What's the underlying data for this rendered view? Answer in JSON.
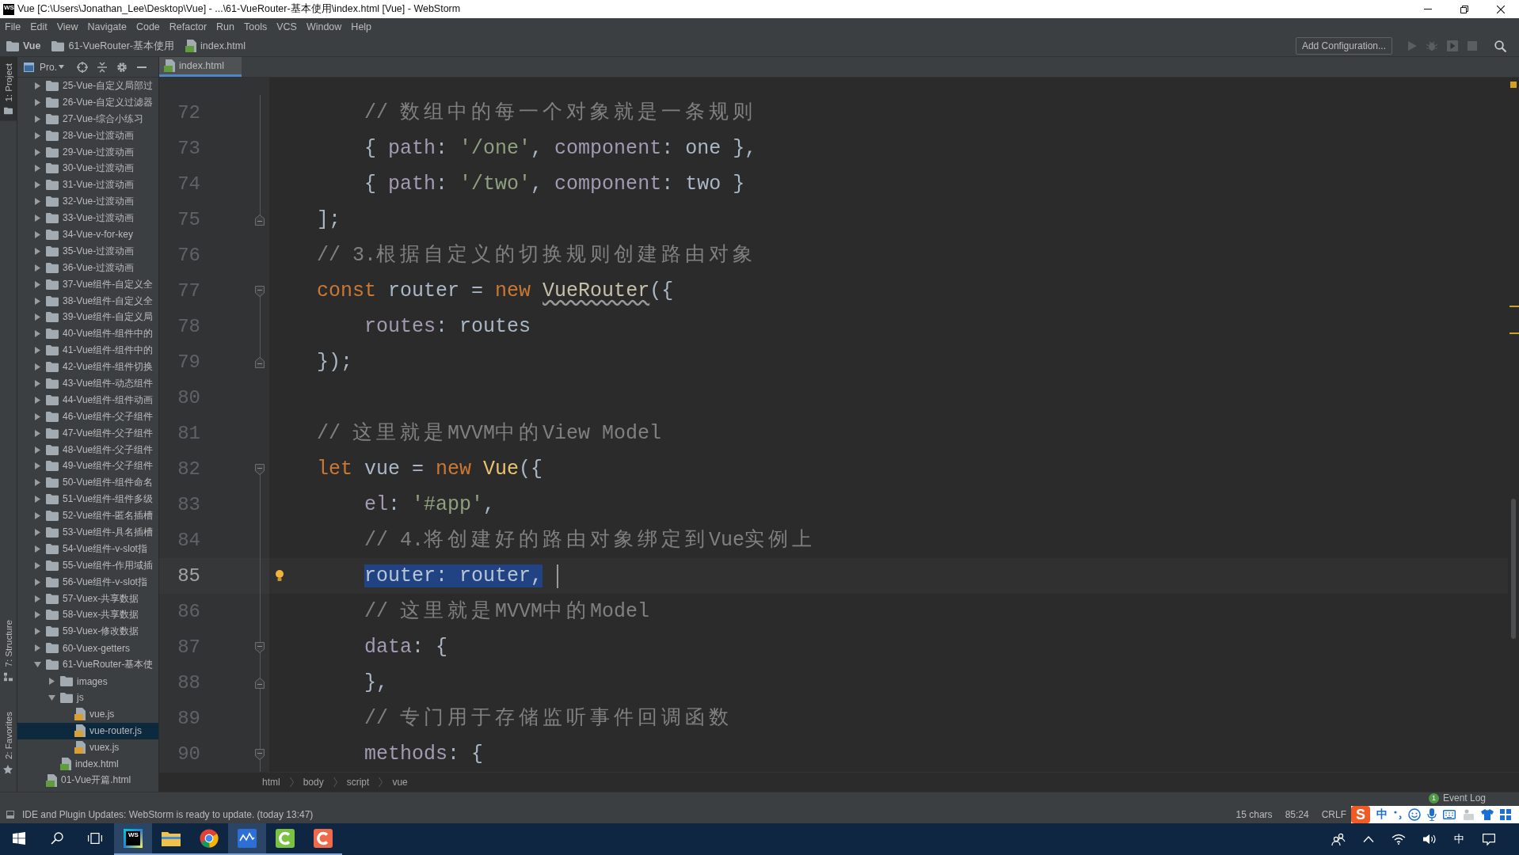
{
  "window": {
    "icon_text": "WS",
    "title": "Vue [C:\\Users\\Jonathan_Lee\\Desktop\\Vue] - ...\\61-VueRouter-基本使用\\index.html [Vue] - WebStorm"
  },
  "menu": [
    "File",
    "Edit",
    "View",
    "Navigate",
    "Code",
    "Refactor",
    "Run",
    "Tools",
    "VCS",
    "Window",
    "Help"
  ],
  "navigation_bar": {
    "crumbs": [
      {
        "label": "Vue",
        "kind": "project"
      },
      {
        "label": "61-VueRouter-基本使用",
        "kind": "folder"
      },
      {
        "label": "index.html",
        "kind": "html"
      }
    ],
    "run_configuration": "Add Configuration...",
    "run_actions_enabled": false
  },
  "left_stripe": {
    "top": [
      {
        "label": "1: Project",
        "kind": "project",
        "selected": true
      }
    ],
    "bottom": [
      {
        "label": "7: Structure",
        "kind": "structure",
        "selected": false
      },
      {
        "label": "2: Favorites",
        "kind": "favorites",
        "selected": false
      }
    ]
  },
  "project_panel": {
    "title": "Pro.",
    "tree": [
      {
        "label": "25-Vue-自定义局部过",
        "kind": "folder",
        "expanded": false,
        "selected": false
      },
      {
        "label": "26-Vue-自定义过滤器",
        "kind": "folder",
        "expanded": false,
        "selected": false
      },
      {
        "label": "27-Vue-综合小练习",
        "kind": "folder",
        "expanded": false,
        "selected": false
      },
      {
        "label": "28-Vue-过渡动画",
        "kind": "folder",
        "expanded": false,
        "selected": false
      },
      {
        "label": "29-Vue-过渡动画",
        "kind": "folder",
        "expanded": false,
        "selected": false
      },
      {
        "label": "30-Vue-过渡动画",
        "kind": "folder",
        "expanded": false,
        "selected": false
      },
      {
        "label": "31-Vue-过渡动画",
        "kind": "folder",
        "expanded": false,
        "selected": false
      },
      {
        "label": "32-Vue-过渡动画",
        "kind": "folder",
        "expanded": false,
        "selected": false
      },
      {
        "label": "33-Vue-过渡动画",
        "kind": "folder",
        "expanded": false,
        "selected": false
      },
      {
        "label": "34-Vue-v-for-key",
        "kind": "folder",
        "expanded": false,
        "selected": false
      },
      {
        "label": "35-Vue-过渡动画",
        "kind": "folder",
        "expanded": false,
        "selected": false
      },
      {
        "label": "36-Vue-过渡动画",
        "kind": "folder",
        "expanded": false,
        "selected": false
      },
      {
        "label": "37-Vue组件-自定义全",
        "kind": "folder",
        "expanded": false,
        "selected": false
      },
      {
        "label": "38-Vue组件-自定义全",
        "kind": "folder",
        "expanded": false,
        "selected": false
      },
      {
        "label": "39-Vue组件-自定义局",
        "kind": "folder",
        "expanded": false,
        "selected": false
      },
      {
        "label": "40-Vue组件-组件中的",
        "kind": "folder",
        "expanded": false,
        "selected": false
      },
      {
        "label": "41-Vue组件-组件中的",
        "kind": "folder",
        "expanded": false,
        "selected": false
      },
      {
        "label": "42-Vue组件-组件切换",
        "kind": "folder",
        "expanded": false,
        "selected": false
      },
      {
        "label": "43-Vue组件-动态组件",
        "kind": "folder",
        "expanded": false,
        "selected": false
      },
      {
        "label": "44-Vue组件-组件动画",
        "kind": "folder",
        "expanded": false,
        "selected": false
      },
      {
        "label": "46-Vue组件-父子组件",
        "kind": "folder",
        "expanded": false,
        "selected": false
      },
      {
        "label": "47-Vue组件-父子组件",
        "kind": "folder",
        "expanded": false,
        "selected": false
      },
      {
        "label": "48-Vue组件-父子组件",
        "kind": "folder",
        "expanded": false,
        "selected": false
      },
      {
        "label": "49-Vue组件-父子组件",
        "kind": "folder",
        "expanded": false,
        "selected": false
      },
      {
        "label": "50-Vue组件-组件命名",
        "kind": "folder",
        "expanded": false,
        "selected": false
      },
      {
        "label": "51-Vue组件-组件多级",
        "kind": "folder",
        "expanded": false,
        "selected": false
      },
      {
        "label": "52-Vue组件-匿名插槽",
        "kind": "folder",
        "expanded": false,
        "selected": false
      },
      {
        "label": "53-Vue组件-具名插槽",
        "kind": "folder",
        "expanded": false,
        "selected": false
      },
      {
        "label": "54-Vue组件-v-slot指",
        "kind": "folder",
        "expanded": false,
        "selected": false
      },
      {
        "label": "55-Vue组件-作用域插",
        "kind": "folder",
        "expanded": false,
        "selected": false
      },
      {
        "label": "56-Vue组件-v-slot指",
        "kind": "folder",
        "expanded": false,
        "selected": false
      },
      {
        "label": "57-Vuex-共享数据",
        "kind": "folder",
        "expanded": false,
        "selected": false
      },
      {
        "label": "58-Vuex-共享数据",
        "kind": "folder",
        "expanded": false,
        "selected": false
      },
      {
        "label": "59-Vuex-修改数据",
        "kind": "folder",
        "expanded": false,
        "selected": false
      },
      {
        "label": "60-Vuex-getters",
        "kind": "folder",
        "expanded": false,
        "selected": false
      },
      {
        "label": "61-VueRouter-基本使",
        "kind": "folder",
        "expanded": true,
        "selected": false,
        "children": [
          {
            "label": "images",
            "kind": "folder",
            "expanded": false,
            "selected": false
          },
          {
            "label": "js",
            "kind": "folder",
            "expanded": true,
            "selected": false,
            "children": [
              {
                "label": "vue.js",
                "kind": "js",
                "selected": false
              },
              {
                "label": "vue-router.js",
                "kind": "js",
                "selected": true
              },
              {
                "label": "vuex.js",
                "kind": "js",
                "selected": false
              }
            ]
          },
          {
            "label": "index.html",
            "kind": "html",
            "selected": false
          }
        ]
      },
      {
        "label": "01-Vue开篇.html",
        "kind": "html",
        "selected": false
      }
    ]
  },
  "editor": {
    "tabs": [
      {
        "label": "index.html",
        "kind": "html",
        "selected": true
      }
    ],
    "lines": [
      {
        "number": "72",
        "current": false,
        "tokens": [
          {
            "kind": "comment",
            "text": "        // 数组中的每一个对象就是一条规则"
          }
        ]
      },
      {
        "number": "73",
        "current": false,
        "tokens": [
          {
            "kind": "plain",
            "text": "        { "
          },
          {
            "kind": "property",
            "text": "path"
          },
          {
            "kind": "plain",
            "text": ": "
          },
          {
            "kind": "string",
            "text": "'/one'"
          },
          {
            "kind": "plain",
            "text": ", "
          },
          {
            "kind": "property",
            "text": "component"
          },
          {
            "kind": "plain",
            "text": ": one },"
          }
        ]
      },
      {
        "number": "74",
        "current": false,
        "tokens": [
          {
            "kind": "plain",
            "text": "        { "
          },
          {
            "kind": "property",
            "text": "path"
          },
          {
            "kind": "plain",
            "text": ": "
          },
          {
            "kind": "string",
            "text": "'/two'"
          },
          {
            "kind": "plain",
            "text": ", "
          },
          {
            "kind": "property",
            "text": "component"
          },
          {
            "kind": "plain",
            "text": ": two }"
          }
        ]
      },
      {
        "number": "75",
        "current": false,
        "fold_end": true,
        "tokens": [
          {
            "kind": "plain",
            "text": "    ];"
          }
        ]
      },
      {
        "number": "76",
        "current": false,
        "tokens": [
          {
            "kind": "comment",
            "text": "    // 3.根据自定义的切换规则创建路由对象"
          }
        ]
      },
      {
        "number": "77",
        "current": false,
        "fold_start": true,
        "tokens": [
          {
            "kind": "keyword",
            "text": "    const"
          },
          {
            "kind": "plain",
            "text": " router = "
          },
          {
            "kind": "keyword",
            "text": "new"
          },
          {
            "kind": "unresolved",
            "text": " VueRouter"
          },
          {
            "kind": "plain",
            "text": "({"
          }
        ]
      },
      {
        "number": "78",
        "current": false,
        "tokens": [
          {
            "kind": "property",
            "text": "        routes"
          },
          {
            "kind": "plain",
            "text": ": routes"
          }
        ]
      },
      {
        "number": "79",
        "current": false,
        "fold_end": true,
        "tokens": [
          {
            "kind": "plain",
            "text": "    });"
          }
        ]
      },
      {
        "number": "80",
        "current": false
      },
      {
        "number": "81",
        "current": false,
        "tokens": [
          {
            "kind": "comment",
            "text": "    // 这里就是MVVM中的View Model"
          }
        ]
      },
      {
        "number": "82",
        "current": false,
        "fold_start": true,
        "tokens": [
          {
            "kind": "keyword",
            "text": "    let"
          },
          {
            "kind": "plain",
            "text": " vue = "
          },
          {
            "kind": "keyword",
            "text": "new"
          },
          {
            "kind": "function",
            "text": " Vue"
          },
          {
            "kind": "plain",
            "text": "({"
          }
        ]
      },
      {
        "number": "83",
        "current": false,
        "tokens": [
          {
            "kind": "property",
            "text": "        el"
          },
          {
            "kind": "plain",
            "text": ": "
          },
          {
            "kind": "string",
            "text": "'#app'"
          },
          {
            "kind": "plain",
            "text": ","
          }
        ]
      },
      {
        "number": "84",
        "current": false,
        "tokens": [
          {
            "kind": "comment",
            "text": "        // 4.将创建好的路由对象绑定到Vue实例上"
          }
        ]
      },
      {
        "number": "85",
        "current": true,
        "intention": true,
        "tokens": [
          {
            "kind": "selection",
            "text": "        router: router,"
          }
        ]
      },
      {
        "number": "86",
        "current": false,
        "tokens": [
          {
            "kind": "comment",
            "text": "        // 这里就是MVVM中的Model"
          }
        ]
      },
      {
        "number": "87",
        "current": false,
        "fold_start": true,
        "tokens": [
          {
            "kind": "property",
            "text": "        data"
          },
          {
            "kind": "plain",
            "text": ": {"
          }
        ]
      },
      {
        "number": "88",
        "current": false,
        "fold_end": true,
        "tokens": [
          {
            "kind": "plain",
            "text": "        },"
          }
        ]
      },
      {
        "number": "89",
        "current": false,
        "tokens": [
          {
            "kind": "comment",
            "text": "        // 专门用于存储监听事件回调函数"
          }
        ]
      },
      {
        "number": "90",
        "current": false,
        "fold_start": true,
        "tokens": [
          {
            "kind": "property",
            "text": "        methods"
          },
          {
            "kind": "plain",
            "text": ": {"
          }
        ]
      }
    ],
    "breadcrumbs": [
      "html",
      "body",
      "script",
      "vue"
    ]
  },
  "bottom_stripe": {
    "event_log": {
      "label": "Event Log",
      "badge": "1"
    }
  },
  "status_bar": {
    "message": "IDE and Plugin Updates: WebStorm is ready to update. (today 13:47)",
    "selection": "15 chars",
    "position": "85:24",
    "line_separator": "CRLF"
  },
  "ime_toolbar": {
    "logo": "S",
    "mode": "中"
  },
  "taskbar": {
    "apps": [
      {
        "kind": "webstorm",
        "label": "WS",
        "active": true
      },
      {
        "kind": "explorer",
        "active": false
      },
      {
        "kind": "chrome",
        "active": false
      },
      {
        "kind": "wave",
        "active": true
      },
      {
        "kind": "camtasia",
        "active": false
      },
      {
        "kind": "recorder",
        "active": false
      }
    ],
    "input_indicator": "中"
  }
}
